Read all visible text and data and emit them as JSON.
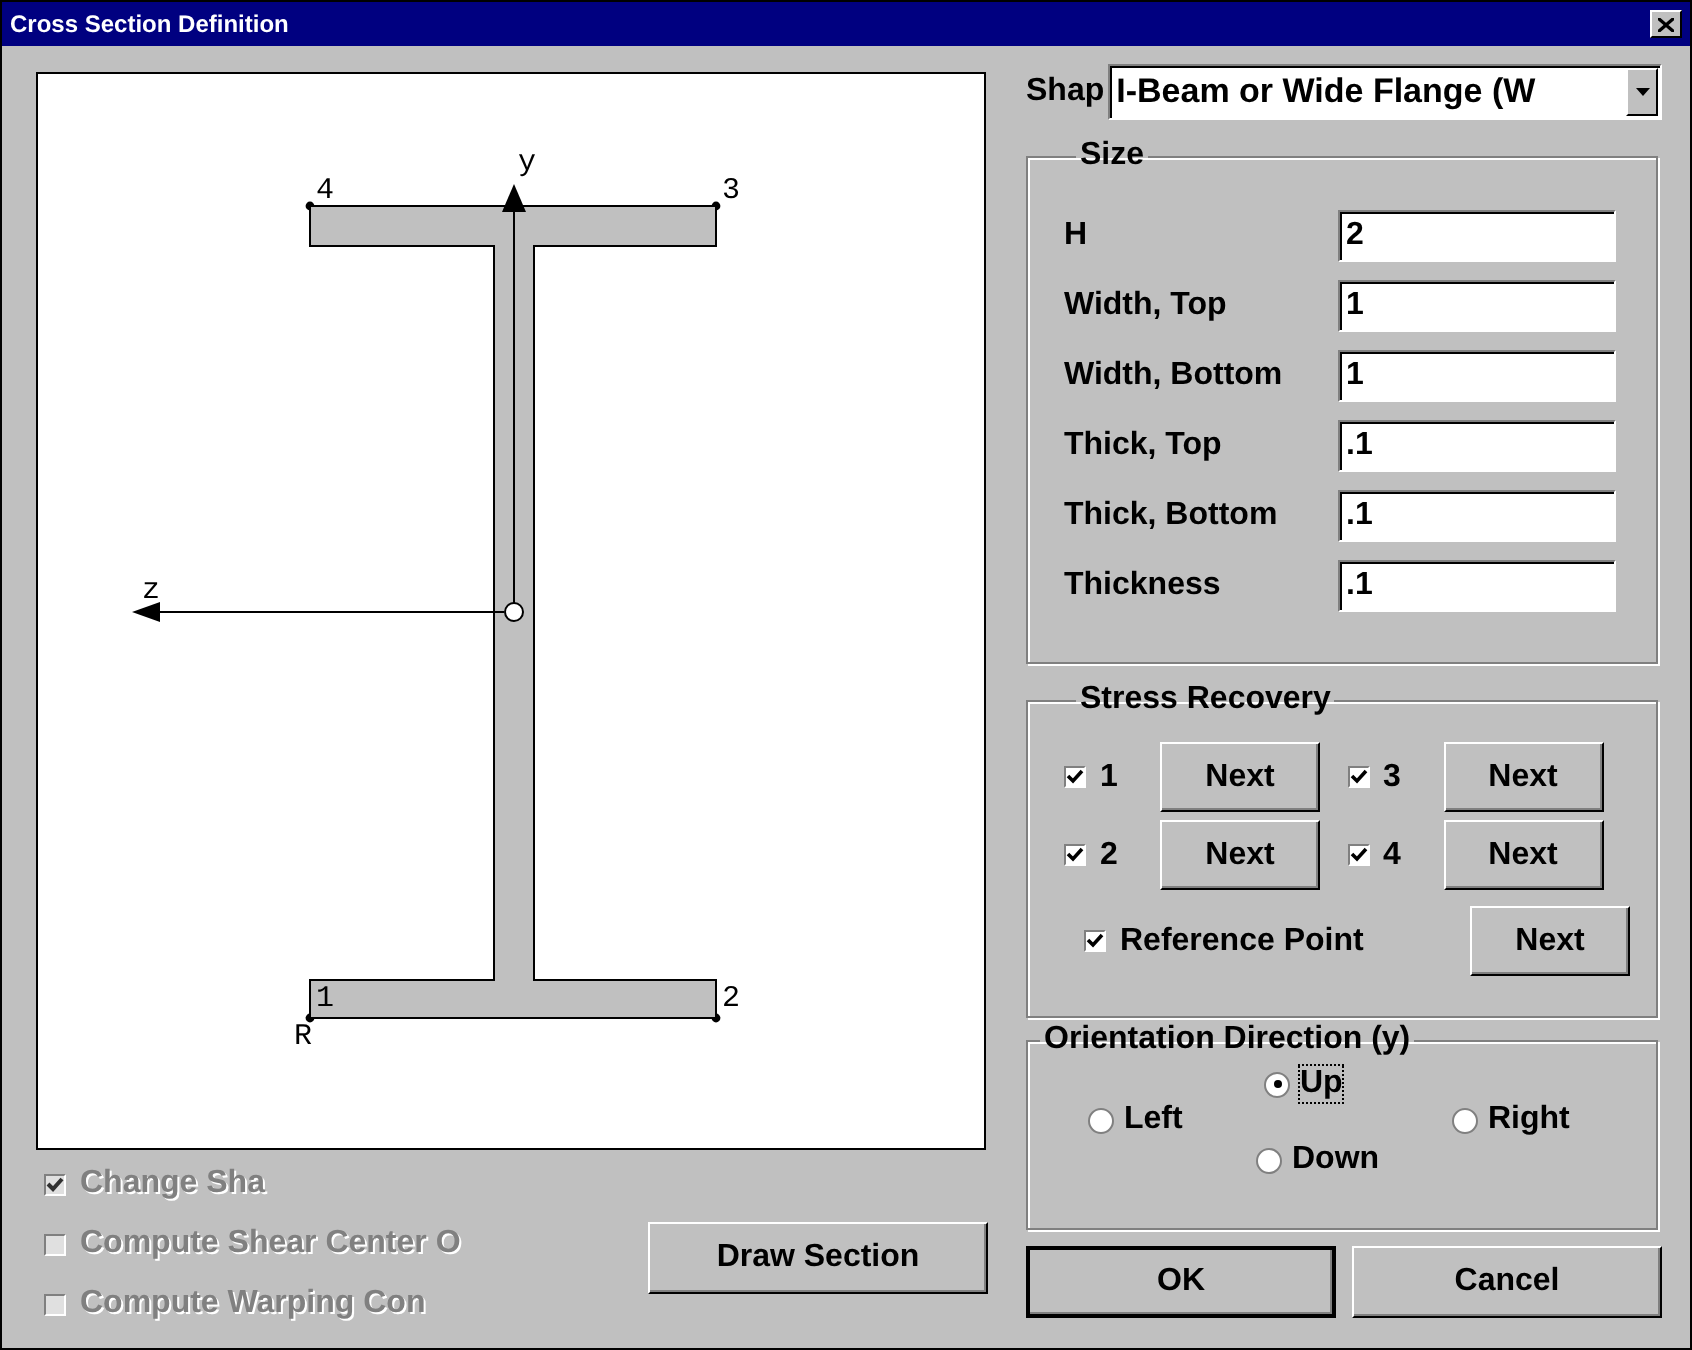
{
  "window": {
    "title": "Cross Section Definition"
  },
  "drawing": {
    "axes": [
      {
        "label": "y"
      },
      {
        "label": "z"
      }
    ],
    "points": [
      {
        "label": "4"
      },
      {
        "label": "3"
      },
      {
        "label": "1"
      },
      {
        "label": "2"
      }
    ],
    "reference_label": "R"
  },
  "options": [
    {
      "label": "Change Sha",
      "checked": true,
      "disabled": true
    },
    {
      "label": "Compute Shear Center O",
      "checked": false,
      "disabled": true
    },
    {
      "label": "Compute Warping Con",
      "checked": false,
      "disabled": true
    }
  ],
  "draw_button": "Draw Section",
  "shape": {
    "label": "Shap",
    "value": "I-Beam or Wide Flange (W"
  },
  "size": {
    "title": "Size",
    "fields": [
      {
        "label": "H",
        "value": "2"
      },
      {
        "label": "Width, Top",
        "value": "1"
      },
      {
        "label": "Width, Bottom",
        "value": "1"
      },
      {
        "label": "Thick, Top",
        "value": ".1"
      },
      {
        "label": "Thick, Bottom",
        "value": ".1"
      },
      {
        "label": "Thickness",
        "value": ".1"
      }
    ]
  },
  "stress_recovery": {
    "title": "Stress Recovery",
    "points": [
      {
        "label": "1",
        "checked": true,
        "button": "Next"
      },
      {
        "label": "3",
        "checked": true,
        "button": "Next"
      },
      {
        "label": "2",
        "checked": true,
        "button": "Next"
      },
      {
        "label": "4",
        "checked": true,
        "button": "Next"
      }
    ],
    "reference": {
      "label": "Reference Point",
      "checked": true,
      "button": "Next"
    }
  },
  "orientation": {
    "title": "Orientation Direction (y)",
    "options": [
      {
        "label": "Up",
        "selected": true
      },
      {
        "label": "Left",
        "selected": false
      },
      {
        "label": "Right",
        "selected": false
      },
      {
        "label": "Down",
        "selected": false
      }
    ]
  },
  "buttons": [
    {
      "label": "OK",
      "default": true
    },
    {
      "label": "Cancel",
      "default": false
    }
  ]
}
